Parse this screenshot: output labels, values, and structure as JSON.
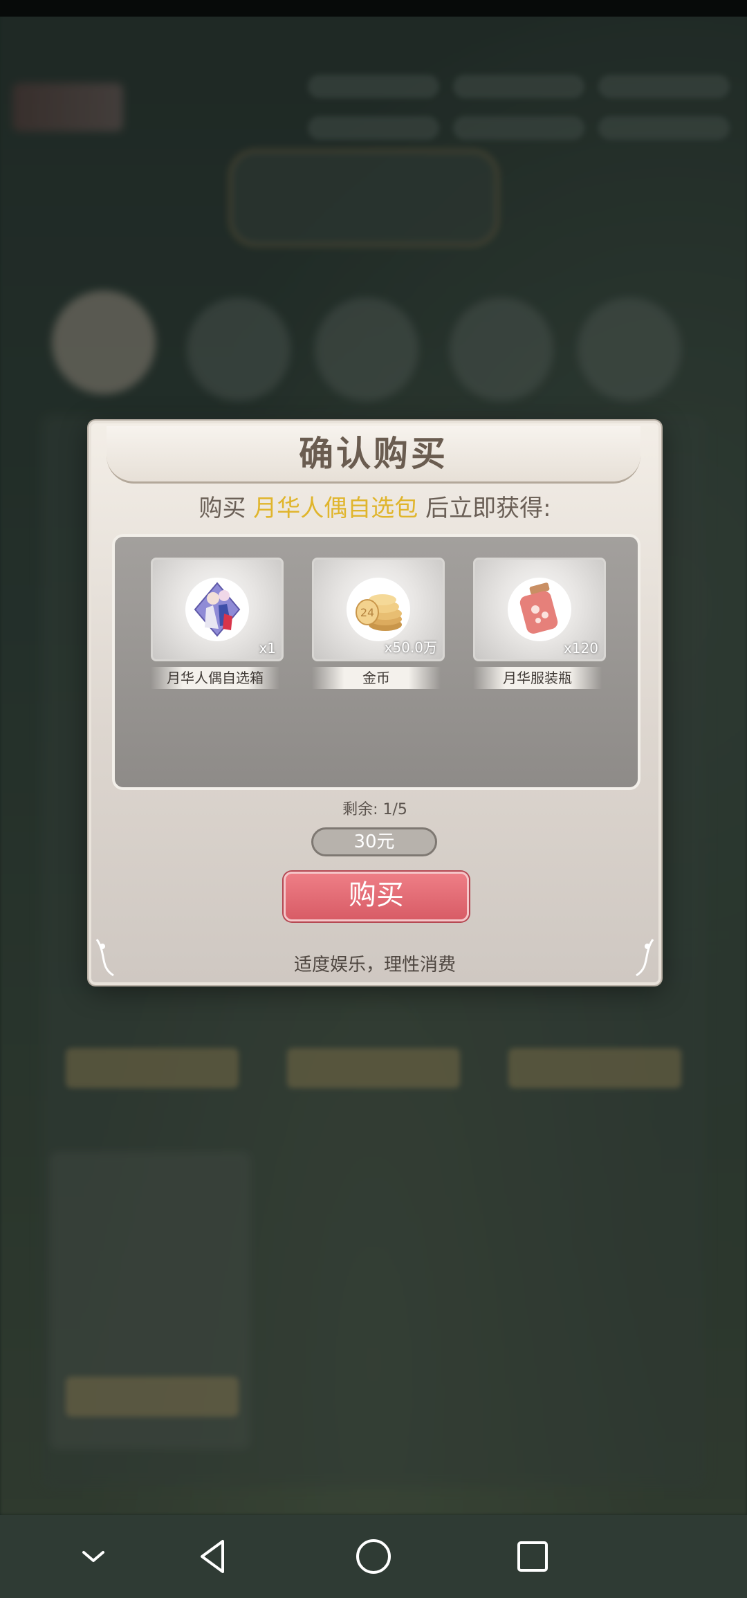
{
  "dialog": {
    "title": "确认购买",
    "subtitle_prefix": "购买 ",
    "package_name": "月华人偶自选包",
    "subtitle_suffix": " 后立即获得:",
    "rewards": [
      {
        "name": "月华人偶自选箱",
        "quantity": "x1",
        "icon": "doll-selection-box-icon"
      },
      {
        "name": "金币",
        "quantity": "x50.0万",
        "icon": "gold-coins-icon"
      },
      {
        "name": "月华服装瓶",
        "quantity": "x120",
        "icon": "costume-bottle-icon"
      }
    ],
    "remaining": "剩余: 1/5",
    "price": "30元",
    "buy_label": "购买",
    "tip": "适度娱乐，理性消费"
  },
  "colors": {
    "highlight": "#e0b52c",
    "buy_button": "#d85c66"
  },
  "navbar": {
    "icons": [
      "chevron-down-icon",
      "back-triangle-icon",
      "home-circle-icon",
      "recents-square-icon"
    ]
  }
}
